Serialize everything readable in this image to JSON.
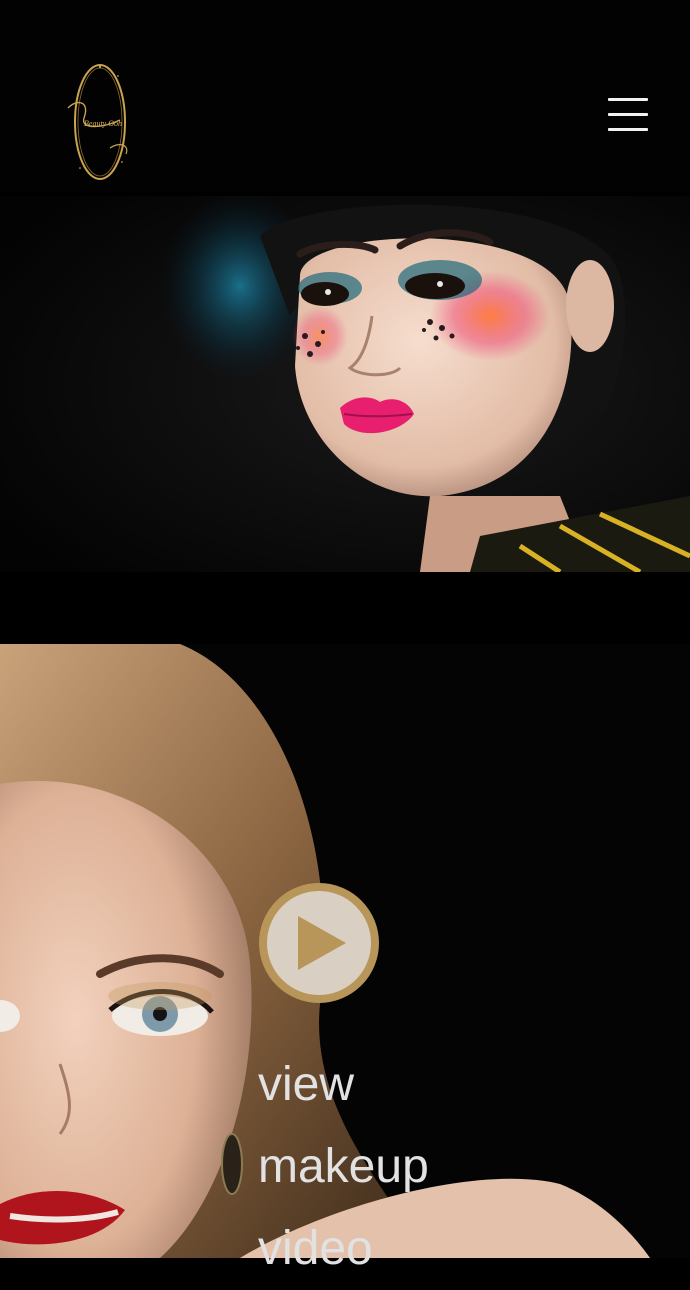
{
  "header": {
    "logo": {
      "text": "Beauty Ooh",
      "accent_color": "#c9a34e"
    },
    "menu": {
      "icon": "hamburger-menu-icon",
      "color": "#f2f2f2"
    }
  },
  "hero": {
    "image": "portrait-artistic-makeup-photo"
  },
  "video_section": {
    "image": "portrait-glam-makeup-photo",
    "play_icon": "play-icon",
    "accent_color": "#b8965a",
    "cta_lines": [
      "view",
      "makeup",
      "video"
    ]
  }
}
